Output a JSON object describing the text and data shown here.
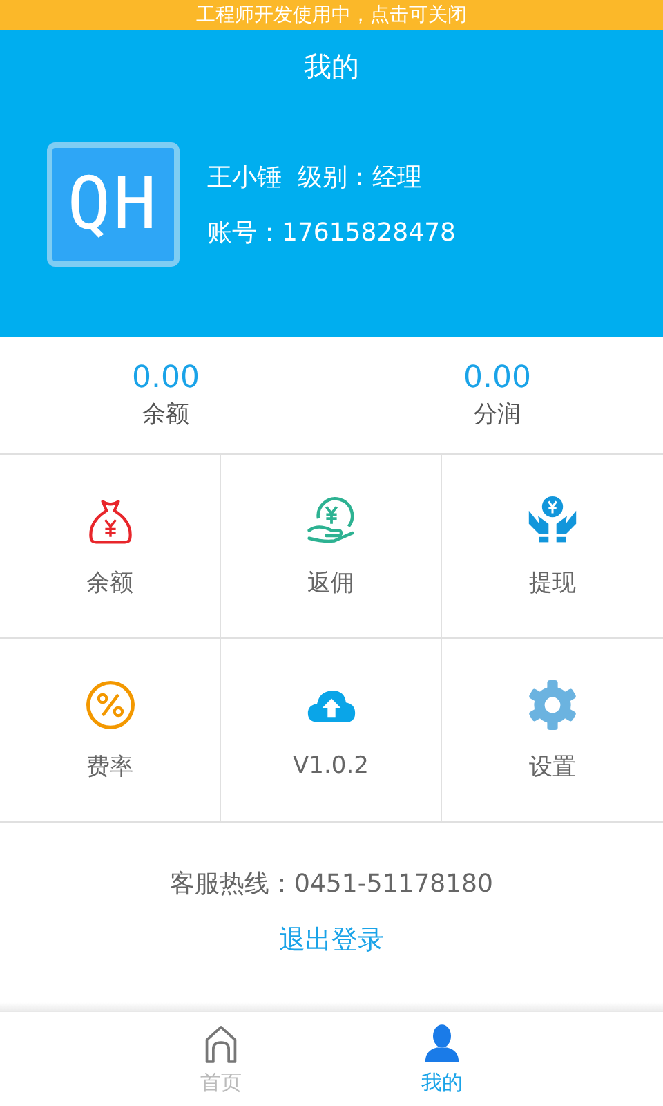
{
  "dev_notice": "工程师开发使用中，点击可关闭",
  "header": {
    "title": "我的",
    "logo": "QH",
    "name_line": "王小锤  级别：经理",
    "account_line": "账号：17615828478"
  },
  "stats": [
    {
      "value": "0.00",
      "label": "余额"
    },
    {
      "value": "0.00",
      "label": "分润"
    }
  ],
  "grid": [
    {
      "kind": "moneybag",
      "label": "余额"
    },
    {
      "kind": "coinhand",
      "label": "返佣"
    },
    {
      "kind": "hands",
      "label": "提现"
    },
    {
      "kind": "percent",
      "label": "费率"
    },
    {
      "kind": "cloud",
      "label": "V1.0.2"
    },
    {
      "kind": "gear",
      "label": "设置"
    }
  ],
  "hotline": "客服热线：0451-51178180",
  "logout": "退出登录",
  "tabs": [
    {
      "kind": "home",
      "label": "首页",
      "selected": false
    },
    {
      "kind": "person",
      "label": "我的",
      "selected": true
    }
  ]
}
